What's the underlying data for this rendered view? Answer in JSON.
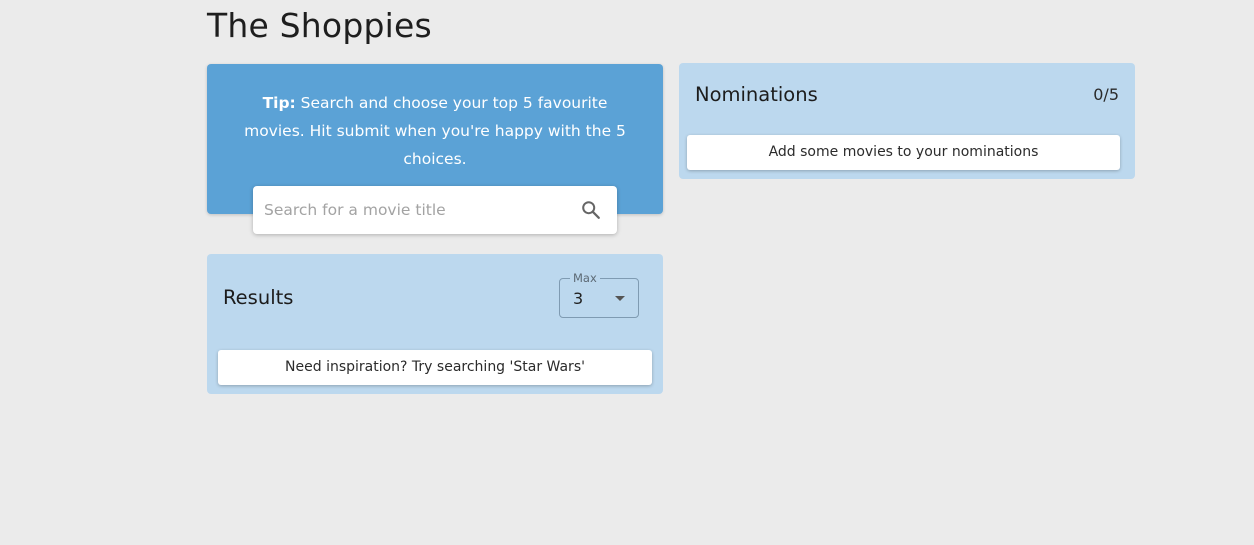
{
  "app": {
    "title": "The Shoppies"
  },
  "tip": {
    "label": "Tip:",
    "text": " Search and choose your top 5 favourite movies. Hit submit when you're happy with the 5 choices."
  },
  "search": {
    "placeholder": "Search for a movie title",
    "value": "",
    "icon": "search-icon"
  },
  "nominations": {
    "heading": "Nominations",
    "count": "0/5",
    "empty_message": "Add some movies to your nominations"
  },
  "results": {
    "heading": "Results",
    "max_label": "Max",
    "max_value": "3",
    "empty_message": "Need inspiration? Try searching 'Star Wars'"
  },
  "colors": {
    "background": "#ebebeb",
    "tip_card": "#5ba2d6",
    "panel": "#bcd8ee"
  }
}
